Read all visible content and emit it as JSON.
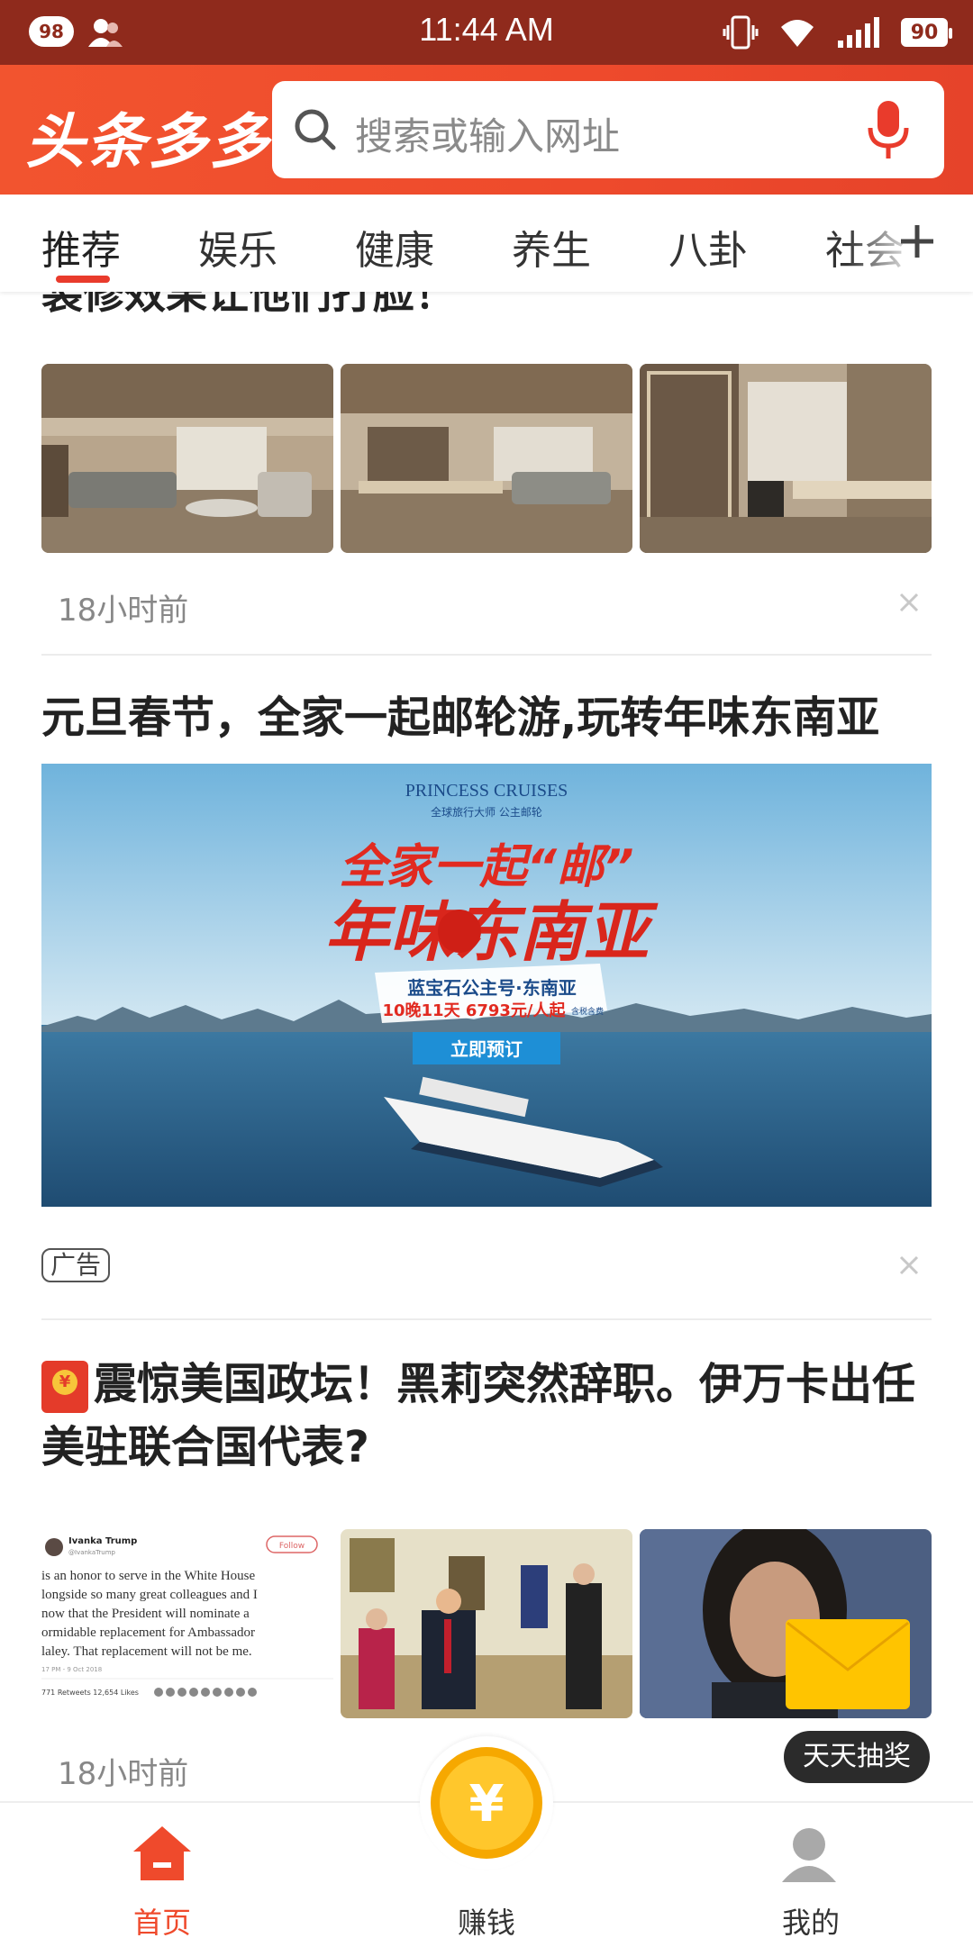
{
  "status_bar": {
    "notification_count": "98",
    "time": "11:44 AM",
    "battery": "90"
  },
  "header": {
    "logo": "头条多多",
    "search_placeholder": "搜索或输入网址",
    "colors": {
      "brand": "#ee4a2c",
      "status_bar": "#8f2a1c"
    }
  },
  "tabs": [
    {
      "label": "推荐",
      "active": true
    },
    {
      "label": "娱乐"
    },
    {
      "label": "健康"
    },
    {
      "label": "养生"
    },
    {
      "label": "八卦"
    },
    {
      "label": "社会"
    }
  ],
  "feed": [
    {
      "title_cut": "装修效果让他们打脸！",
      "images": [
        "living-room-photo",
        "dining-room-photo",
        "study-room-photo"
      ],
      "time": "18小时前"
    },
    {
      "title": "元旦春节，全家一起邮轮游,玩转年味东南亚",
      "banner": {
        "brand": "PRINCESS CRUISES",
        "brand_sub": "全球旅行大师  公主邮轮",
        "headline1": "全家一起“邮”",
        "headline2": "年味东南亚",
        "ship": "蓝宝石公主号·东南亚",
        "price": "10晚11天 6793元/人起",
        "price_note": "含税含费",
        "cta": "立即预订"
      },
      "tag": "广告"
    },
    {
      "title": "震惊美国政坛！黑莉突然辞职。伊万卡出任美驻联合国代表?",
      "images": [
        "tweet-screenshot",
        "oval-office-photo",
        "portrait-photo"
      ],
      "tweet": {
        "name": "Ivanka Trump",
        "handle": "@IvankaTrump",
        "follow": "Follow",
        "lines": [
          "is an honor to serve in the White House",
          "longside so many great colleagues and I",
          "now that the President will nominate a",
          "ormidable replacement for Ambassador",
          "laley. That replacement will not be me."
        ],
        "date": "17 PM - 9 Oct 2018",
        "stats": "771 Retweets  12,654 Likes"
      },
      "time": "18小时前"
    }
  ],
  "float": {
    "lottery": "天天抽奖"
  },
  "bottom_nav": [
    {
      "label": "首页",
      "active": true
    },
    {
      "label": "赚钱"
    },
    {
      "label": "我的"
    }
  ],
  "bottom_nav_coin": "¥"
}
